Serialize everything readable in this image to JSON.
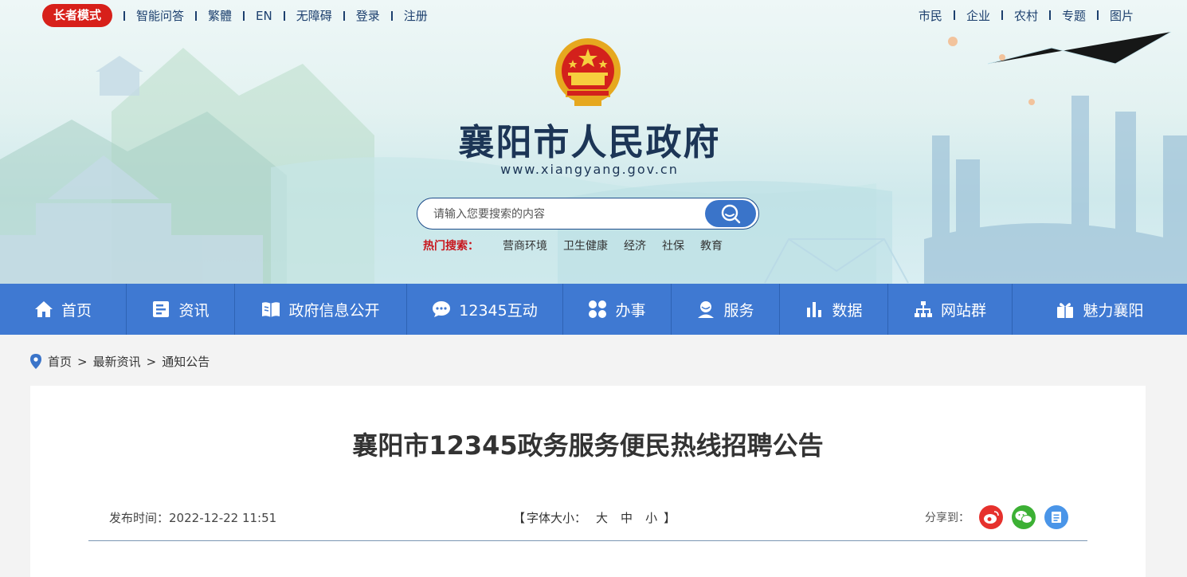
{
  "topbar": {
    "elder_mode": "长者模式",
    "left_links": [
      "智能问答",
      "繁體",
      "EN",
      "无障碍",
      "登录",
      "注册"
    ],
    "right_links": [
      "市民",
      "企业",
      "农村",
      "专题",
      "图片"
    ]
  },
  "header": {
    "title": "襄阳市人民政府",
    "url": "www.xiangyang.gov.cn"
  },
  "search": {
    "placeholder": "请输入您要搜索的内容",
    "hot_label": "热门搜索：",
    "hot_items": [
      "营商环境",
      "卫生健康",
      "经济",
      "社保",
      "教育"
    ]
  },
  "nav": {
    "items": [
      {
        "label": "首页",
        "icon": "home-icon"
      },
      {
        "label": "资讯",
        "icon": "news-icon"
      },
      {
        "label": "政府信息公开",
        "icon": "book-icon"
      },
      {
        "label": "12345互动",
        "icon": "chat-icon"
      },
      {
        "label": "办事",
        "icon": "grid-icon"
      },
      {
        "label": "服务",
        "icon": "user-service-icon"
      },
      {
        "label": "数据",
        "icon": "bar-chart-icon"
      },
      {
        "label": "网站群",
        "icon": "sitemap-icon"
      },
      {
        "label": "魅力襄阳",
        "icon": "gift-icon"
      }
    ]
  },
  "breadcrumb": [
    "首页",
    "最新资讯",
    "通知公告"
  ],
  "article": {
    "title": "襄阳市12345政务服务便民热线招聘公告",
    "publish_label": "发布时间：",
    "publish_time": "2022-12-22 11:51",
    "font_open": "【",
    "font_label": "字体大小：",
    "font_options": [
      "大",
      "中",
      "小"
    ],
    "font_close": "】",
    "share_label": "分享到："
  },
  "colors": {
    "nav_bg": "#3f79d2",
    "elder_btn": "#d7201a",
    "hot_label": "#c8161d",
    "weibo": "#e6312d",
    "wechat": "#3cb034",
    "other_share": "#4a95e8"
  }
}
